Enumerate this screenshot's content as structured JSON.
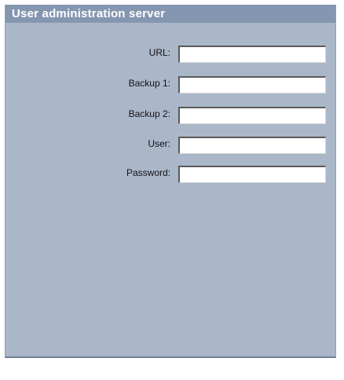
{
  "panel": {
    "title": "User administration server"
  },
  "fields": [
    {
      "label": "URL:",
      "value": "",
      "placeholder": ""
    },
    {
      "label": "Backup 1:",
      "value": "",
      "placeholder": ""
    },
    {
      "label": "Backup 2:",
      "value": "",
      "placeholder": ""
    },
    {
      "label": "User:",
      "value": "",
      "placeholder": ""
    },
    {
      "label": "Password:",
      "value": "",
      "placeholder": ""
    }
  ],
  "colors": {
    "panel_background": "#aab7c9",
    "header_background": "#8596b0",
    "header_text": "#ffffff"
  }
}
